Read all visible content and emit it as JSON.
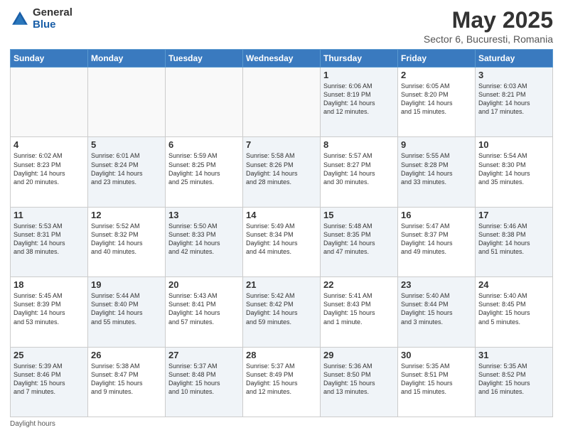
{
  "header": {
    "logo_general": "General",
    "logo_blue": "Blue",
    "month": "May 2025",
    "location": "Sector 6, Bucuresti, Romania"
  },
  "days_of_week": [
    "Sunday",
    "Monday",
    "Tuesday",
    "Wednesday",
    "Thursday",
    "Friday",
    "Saturday"
  ],
  "weeks": [
    [
      {
        "day": "",
        "content": ""
      },
      {
        "day": "",
        "content": ""
      },
      {
        "day": "",
        "content": ""
      },
      {
        "day": "",
        "content": ""
      },
      {
        "day": "1",
        "content": "Sunrise: 6:06 AM\nSunset: 8:19 PM\nDaylight: 14 hours\nand 12 minutes."
      },
      {
        "day": "2",
        "content": "Sunrise: 6:05 AM\nSunset: 8:20 PM\nDaylight: 14 hours\nand 15 minutes."
      },
      {
        "day": "3",
        "content": "Sunrise: 6:03 AM\nSunset: 8:21 PM\nDaylight: 14 hours\nand 17 minutes."
      }
    ],
    [
      {
        "day": "4",
        "content": "Sunrise: 6:02 AM\nSunset: 8:23 PM\nDaylight: 14 hours\nand 20 minutes."
      },
      {
        "day": "5",
        "content": "Sunrise: 6:01 AM\nSunset: 8:24 PM\nDaylight: 14 hours\nand 23 minutes."
      },
      {
        "day": "6",
        "content": "Sunrise: 5:59 AM\nSunset: 8:25 PM\nDaylight: 14 hours\nand 25 minutes."
      },
      {
        "day": "7",
        "content": "Sunrise: 5:58 AM\nSunset: 8:26 PM\nDaylight: 14 hours\nand 28 minutes."
      },
      {
        "day": "8",
        "content": "Sunrise: 5:57 AM\nSunset: 8:27 PM\nDaylight: 14 hours\nand 30 minutes."
      },
      {
        "day": "9",
        "content": "Sunrise: 5:55 AM\nSunset: 8:28 PM\nDaylight: 14 hours\nand 33 minutes."
      },
      {
        "day": "10",
        "content": "Sunrise: 5:54 AM\nSunset: 8:30 PM\nDaylight: 14 hours\nand 35 minutes."
      }
    ],
    [
      {
        "day": "11",
        "content": "Sunrise: 5:53 AM\nSunset: 8:31 PM\nDaylight: 14 hours\nand 38 minutes."
      },
      {
        "day": "12",
        "content": "Sunrise: 5:52 AM\nSunset: 8:32 PM\nDaylight: 14 hours\nand 40 minutes."
      },
      {
        "day": "13",
        "content": "Sunrise: 5:50 AM\nSunset: 8:33 PM\nDaylight: 14 hours\nand 42 minutes."
      },
      {
        "day": "14",
        "content": "Sunrise: 5:49 AM\nSunset: 8:34 PM\nDaylight: 14 hours\nand 44 minutes."
      },
      {
        "day": "15",
        "content": "Sunrise: 5:48 AM\nSunset: 8:35 PM\nDaylight: 14 hours\nand 47 minutes."
      },
      {
        "day": "16",
        "content": "Sunrise: 5:47 AM\nSunset: 8:37 PM\nDaylight: 14 hours\nand 49 minutes."
      },
      {
        "day": "17",
        "content": "Sunrise: 5:46 AM\nSunset: 8:38 PM\nDaylight: 14 hours\nand 51 minutes."
      }
    ],
    [
      {
        "day": "18",
        "content": "Sunrise: 5:45 AM\nSunset: 8:39 PM\nDaylight: 14 hours\nand 53 minutes."
      },
      {
        "day": "19",
        "content": "Sunrise: 5:44 AM\nSunset: 8:40 PM\nDaylight: 14 hours\nand 55 minutes."
      },
      {
        "day": "20",
        "content": "Sunrise: 5:43 AM\nSunset: 8:41 PM\nDaylight: 14 hours\nand 57 minutes."
      },
      {
        "day": "21",
        "content": "Sunrise: 5:42 AM\nSunset: 8:42 PM\nDaylight: 14 hours\nand 59 minutes."
      },
      {
        "day": "22",
        "content": "Sunrise: 5:41 AM\nSunset: 8:43 PM\nDaylight: 15 hours\nand 1 minute."
      },
      {
        "day": "23",
        "content": "Sunrise: 5:40 AM\nSunset: 8:44 PM\nDaylight: 15 hours\nand 3 minutes."
      },
      {
        "day": "24",
        "content": "Sunrise: 5:40 AM\nSunset: 8:45 PM\nDaylight: 15 hours\nand 5 minutes."
      }
    ],
    [
      {
        "day": "25",
        "content": "Sunrise: 5:39 AM\nSunset: 8:46 PM\nDaylight: 15 hours\nand 7 minutes."
      },
      {
        "day": "26",
        "content": "Sunrise: 5:38 AM\nSunset: 8:47 PM\nDaylight: 15 hours\nand 9 minutes."
      },
      {
        "day": "27",
        "content": "Sunrise: 5:37 AM\nSunset: 8:48 PM\nDaylight: 15 hours\nand 10 minutes."
      },
      {
        "day": "28",
        "content": "Sunrise: 5:37 AM\nSunset: 8:49 PM\nDaylight: 15 hours\nand 12 minutes."
      },
      {
        "day": "29",
        "content": "Sunrise: 5:36 AM\nSunset: 8:50 PM\nDaylight: 15 hours\nand 13 minutes."
      },
      {
        "day": "30",
        "content": "Sunrise: 5:35 AM\nSunset: 8:51 PM\nDaylight: 15 hours\nand 15 minutes."
      },
      {
        "day": "31",
        "content": "Sunrise: 5:35 AM\nSunset: 8:52 PM\nDaylight: 15 hours\nand 16 minutes."
      }
    ]
  ],
  "footer": {
    "note": "Daylight hours"
  }
}
